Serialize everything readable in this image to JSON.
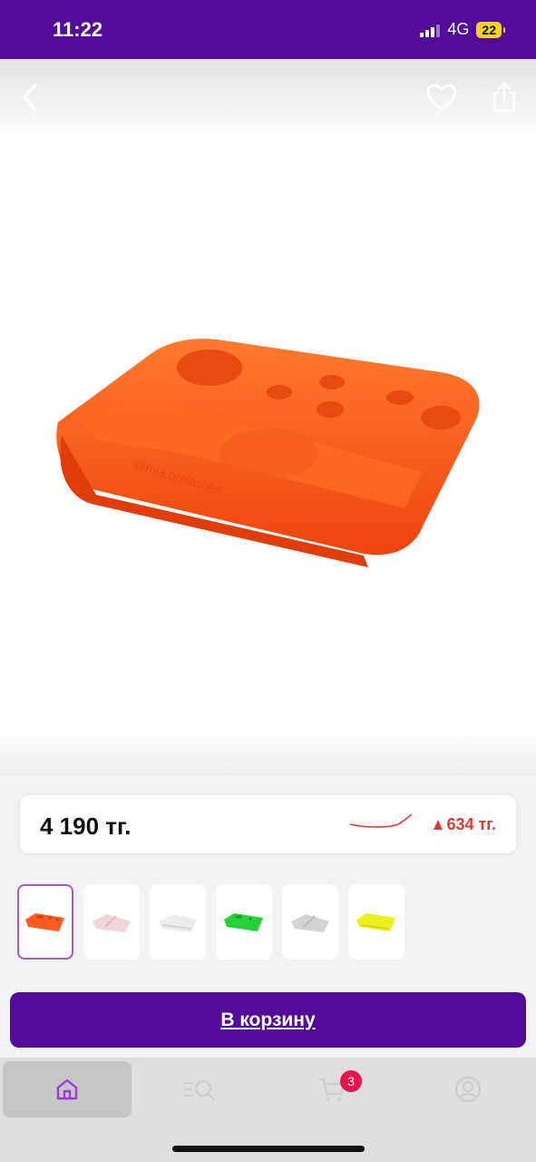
{
  "status_bar": {
    "time": "11:22",
    "network": "4G",
    "battery": "22"
  },
  "nav": {
    "back_icon": "chevron-left-icon",
    "favorite_icon": "heart-icon",
    "share_icon": "share-icon"
  },
  "product": {
    "image_alt": "orange-lash-tray",
    "watermark": "@mia.prolashes"
  },
  "price_card": {
    "price": "4 190 тг.",
    "diff": "634 тг.",
    "diff_color": "#e53935"
  },
  "thumbnails": [
    {
      "name": "orange",
      "color": "#ff5a1f",
      "active": true
    },
    {
      "name": "pink",
      "color": "#f2d5da",
      "active": false
    },
    {
      "name": "white",
      "color": "#f1f1f1",
      "active": false
    },
    {
      "name": "green",
      "color": "#27d13a",
      "active": false
    },
    {
      "name": "gray",
      "color": "#d3d3d3",
      "active": false
    },
    {
      "name": "yellow",
      "color": "#eef01e",
      "active": false
    }
  ],
  "cart_button": {
    "label": "В корзину"
  },
  "tabbar": {
    "items": [
      {
        "name": "home",
        "icon": "home-icon",
        "active": true
      },
      {
        "name": "catalog",
        "icon": "catalog-search-icon",
        "active": false
      },
      {
        "name": "cart",
        "icon": "cart-icon",
        "active": false,
        "badge": "3"
      },
      {
        "name": "profile",
        "icon": "profile-icon",
        "active": false
      }
    ]
  },
  "colors": {
    "brand": "#520c98",
    "accent": "#a05ad6",
    "badge": "#e8154a"
  }
}
